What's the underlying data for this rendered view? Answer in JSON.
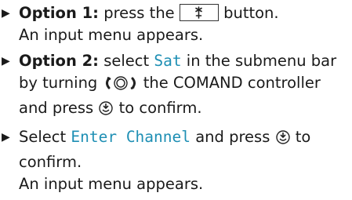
{
  "steps": [
    {
      "bold": "Option 1:",
      "t1": "press the",
      "key_icon": "asterisk-key-icon",
      "t2": "button.",
      "line2": "An input menu appears."
    },
    {
      "bold": "Option 2:",
      "t1": "select",
      "term": "Sat",
      "t2": "in the submenu bar",
      "t3": "by turning",
      "ctrl_icon": "controller-turn-icon",
      "t4": "the COMAND controller",
      "t5": "and press",
      "press_icon": "controller-press-icon",
      "t6": "to confirm."
    },
    {
      "t1": "Select",
      "term": "Enter Channel",
      "t2": "and press",
      "press_icon": "controller-press-icon",
      "t3": "to",
      "line2": "confirm.",
      "line3": "An input menu appears."
    }
  ]
}
